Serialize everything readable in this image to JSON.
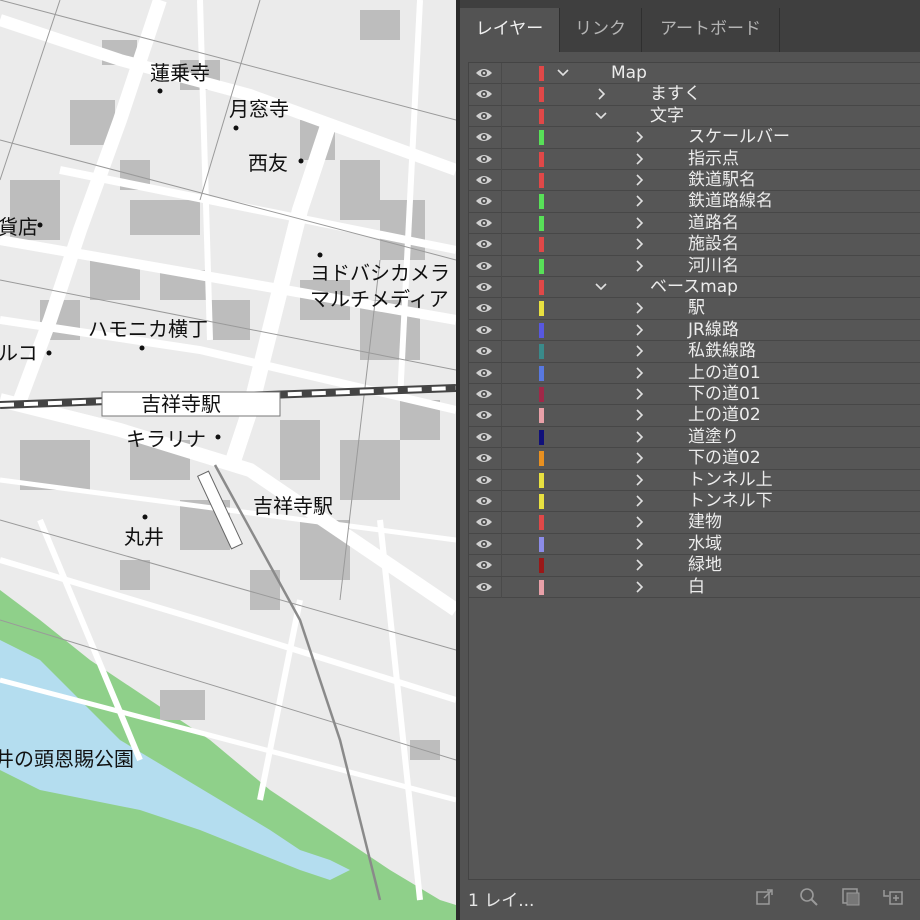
{
  "map": {
    "labels": [
      {
        "id": "rengeji",
        "text": "蓮乗寺"
      },
      {
        "id": "getsusoji",
        "text": "月窓寺"
      },
      {
        "id": "seiyu",
        "text": "西友"
      },
      {
        "id": "department",
        "text": "貨店"
      },
      {
        "id": "yodobashi1",
        "text": "ヨドバシカメラ"
      },
      {
        "id": "yodobashi2",
        "text": "マルチメディア"
      },
      {
        "id": "harmonica",
        "text": "ハモニカ横丁"
      },
      {
        "id": "parco",
        "text": "ルコ"
      },
      {
        "id": "station1",
        "text": "吉祥寺駅"
      },
      {
        "id": "kirarina",
        "text": "キラリナ"
      },
      {
        "id": "station2",
        "text": "吉祥寺駅"
      },
      {
        "id": "marui",
        "text": "丸井"
      },
      {
        "id": "park",
        "text": "井の頭恩賜公園"
      }
    ]
  },
  "panel": {
    "tabs": [
      {
        "label": "レイヤー",
        "active": true
      },
      {
        "label": "リンク",
        "active": false
      },
      {
        "label": "アートボード",
        "active": false
      }
    ],
    "layers": [
      {
        "label": "Map",
        "level": 0,
        "expanded": true,
        "color": "#e04848"
      },
      {
        "label": "ますく",
        "level": 1,
        "expanded": false,
        "color": "#e04848"
      },
      {
        "label": "文字",
        "level": 1,
        "expanded": true,
        "color": "#e04848"
      },
      {
        "label": "スケールバー",
        "level": 2,
        "expanded": false,
        "color": "#58e058"
      },
      {
        "label": "指示点",
        "level": 2,
        "expanded": false,
        "color": "#e04848"
      },
      {
        "label": "鉄道駅名",
        "level": 2,
        "expanded": false,
        "color": "#e04848"
      },
      {
        "label": "鉄道路線名",
        "level": 2,
        "expanded": false,
        "color": "#58e058"
      },
      {
        "label": "道路名",
        "level": 2,
        "expanded": false,
        "color": "#58e058"
      },
      {
        "label": "施設名",
        "level": 2,
        "expanded": false,
        "color": "#e04848"
      },
      {
        "label": "河川名",
        "level": 2,
        "expanded": false,
        "color": "#58e058"
      },
      {
        "label": "ベースmap",
        "level": 1,
        "expanded": true,
        "color": "#e04848"
      },
      {
        "label": "駅",
        "level": 2,
        "expanded": false,
        "color": "#e8e040"
      },
      {
        "label": "JR線路",
        "level": 2,
        "expanded": false,
        "color": "#5858e0"
      },
      {
        "label": "私鉄線路",
        "level": 2,
        "expanded": false,
        "color": "#3a8a8a"
      },
      {
        "label": "上の道01",
        "level": 2,
        "expanded": false,
        "color": "#5878e0"
      },
      {
        "label": "下の道01",
        "level": 2,
        "expanded": false,
        "color": "#a02848"
      },
      {
        "label": "上の道02",
        "level": 2,
        "expanded": false,
        "color": "#e8a0a8"
      },
      {
        "label": "道塗り",
        "level": 2,
        "expanded": false,
        "color": "#10107a"
      },
      {
        "label": "下の道02",
        "level": 2,
        "expanded": false,
        "color": "#e89020"
      },
      {
        "label": "トンネル上",
        "level": 2,
        "expanded": false,
        "color": "#e8e040"
      },
      {
        "label": "トンネル下",
        "level": 2,
        "expanded": false,
        "color": "#e8e040"
      },
      {
        "label": "建物",
        "level": 2,
        "expanded": false,
        "color": "#e04848"
      },
      {
        "label": "水域",
        "level": 2,
        "expanded": false,
        "color": "#8c8ce8"
      },
      {
        "label": "緑地",
        "level": 2,
        "expanded": false,
        "color": "#9a1818"
      },
      {
        "label": "白",
        "level": 2,
        "expanded": false,
        "color": "#e8a0a8"
      }
    ],
    "footer": {
      "count": "1 レイ...",
      "icons": [
        "export-icon",
        "locate-object-icon",
        "clipping-mask-icon",
        "new-sublayer-icon"
      ]
    }
  }
}
